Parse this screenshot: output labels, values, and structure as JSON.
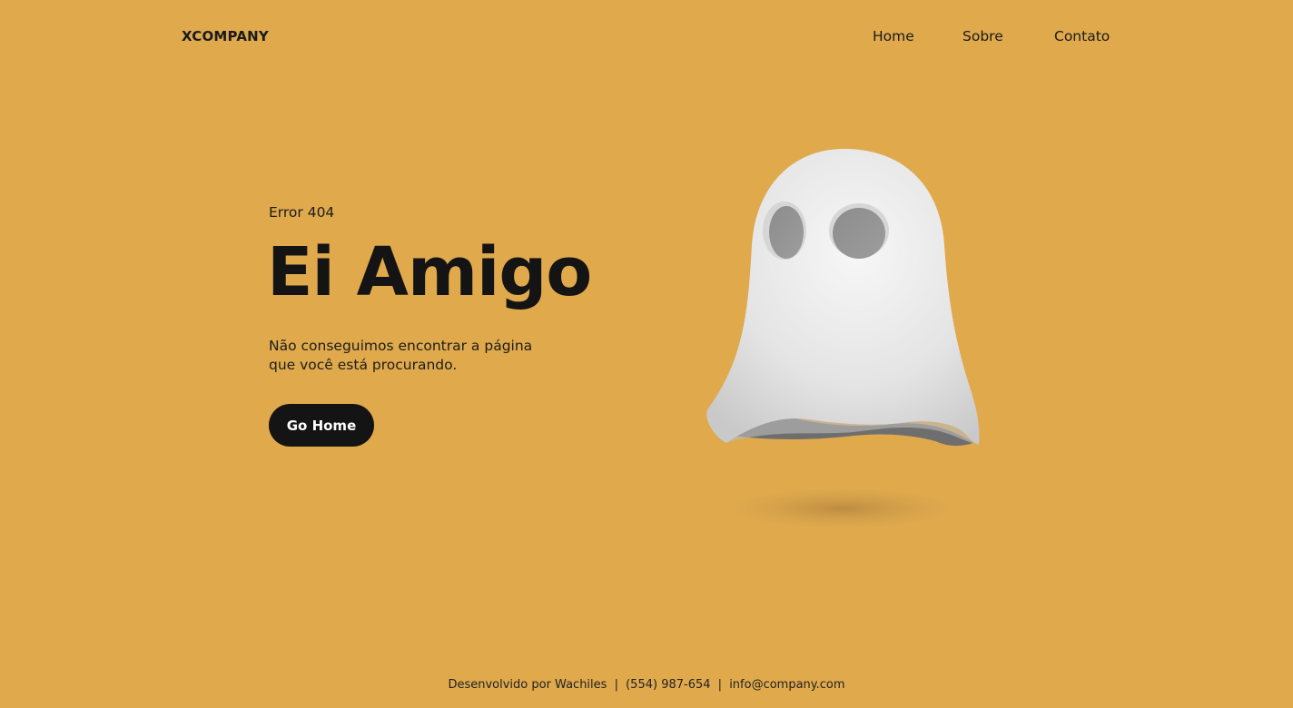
{
  "brand": {
    "name": "XCOMPANY"
  },
  "nav": {
    "items": [
      {
        "label": "Home"
      },
      {
        "label": "Sobre"
      },
      {
        "label": "Contato"
      }
    ]
  },
  "hero": {
    "eyebrow": "Error 404",
    "headline": "Ei Amigo",
    "message": "Não conseguimos encontrar a página que você está procurando.",
    "cta_label": "Go Home"
  },
  "illustration": {
    "icon": "ghost-icon",
    "description_colors": {
      "body": "#ececec",
      "shadow": "#c4944a"
    }
  },
  "footer": {
    "credit": "Desenvolvido por Wachiles",
    "separator": "|",
    "phone": "(554) 987-654",
    "email": "info@company.com"
  },
  "colors": {
    "background": "#dfa94c",
    "text": "#161616",
    "button_bg": "#141414",
    "button_text": "#ffffff"
  }
}
